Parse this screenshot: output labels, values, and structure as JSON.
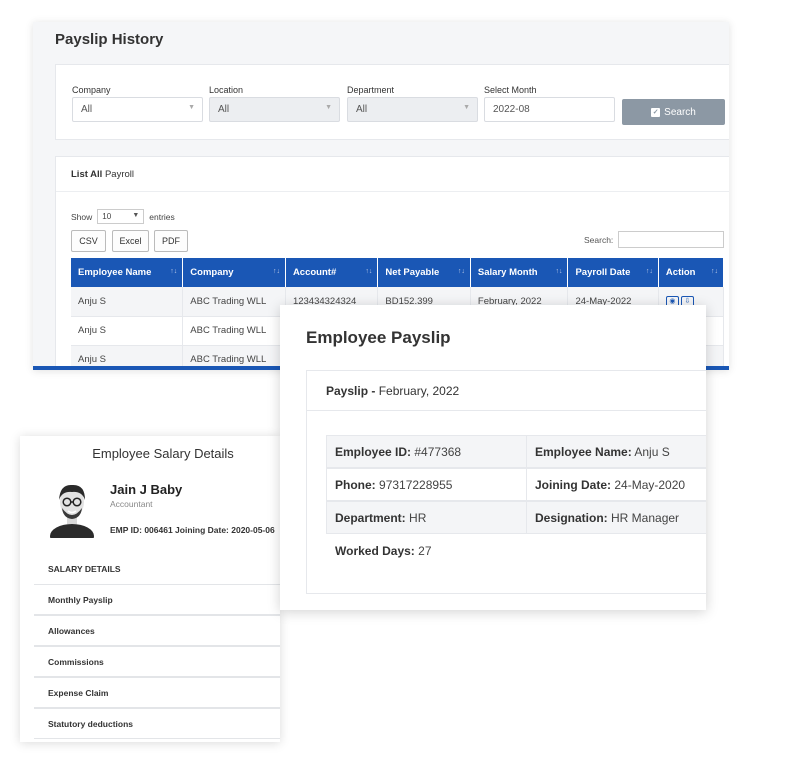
{
  "history": {
    "title": "Payslip History",
    "filters": {
      "company_label": "Company",
      "company_value": "All",
      "location_label": "Location",
      "location_value": "All",
      "department_label": "Department",
      "department_value": "All",
      "month_label": "Select Month",
      "month_value": "2022-08",
      "search_button": "Search"
    },
    "list": {
      "title_bold": "List All",
      "title_rest": "Payroll",
      "show_label": "Show",
      "entries_value": "10",
      "entries_label": "entries",
      "buttons": {
        "csv": "CSV",
        "excel": "Excel",
        "pdf": "PDF"
      },
      "search_label": "Search:"
    },
    "table": {
      "headers": [
        "Employee Name",
        "Company",
        "Account#",
        "Net Payable",
        "Salary Month",
        "Payroll Date",
        "Action"
      ],
      "rows": [
        [
          "Anju S",
          "ABC Trading WLL",
          "123434324324",
          "BD152.399",
          "February, 2022",
          "24-May-2022"
        ],
        [
          "Anju S",
          "ABC Trading WLL",
          "",
          "",
          "",
          ""
        ],
        [
          "Anju S",
          "ABC Trading WLL",
          "",
          "",
          "",
          ""
        ]
      ]
    }
  },
  "payslip": {
    "title": "Employee Payslip",
    "sub_bold": "Payslip -",
    "sub_rest": "February, 2022",
    "fields": {
      "emp_id_label": "Employee ID:",
      "emp_id_value": "#477368",
      "emp_name_label": "Employee Name:",
      "emp_name_value": "Anju S",
      "phone_label": "Phone:",
      "phone_value": "97317228955",
      "joining_label": "Joining Date:",
      "joining_value": "24-May-2020",
      "dept_label": "Department:",
      "dept_value": "HR",
      "desig_label": "Designation:",
      "desig_value": "HR Manager",
      "worked_label": "Worked Days:",
      "worked_value": "27"
    }
  },
  "salary": {
    "title": "Employee Salary Details",
    "name": "Jain J Baby",
    "role": "Accountant",
    "meta": "EMP ID:  006461 Joining Date:  2020-05-06",
    "section": "SALARY DETAILS",
    "menu": [
      "Monthly Payslip",
      "Allowances",
      "Commissions",
      "Expense Claim",
      "Statutory deductions"
    ]
  },
  "colors": {
    "primary": "#1a57b5",
    "search_button": "#8c98a4"
  }
}
